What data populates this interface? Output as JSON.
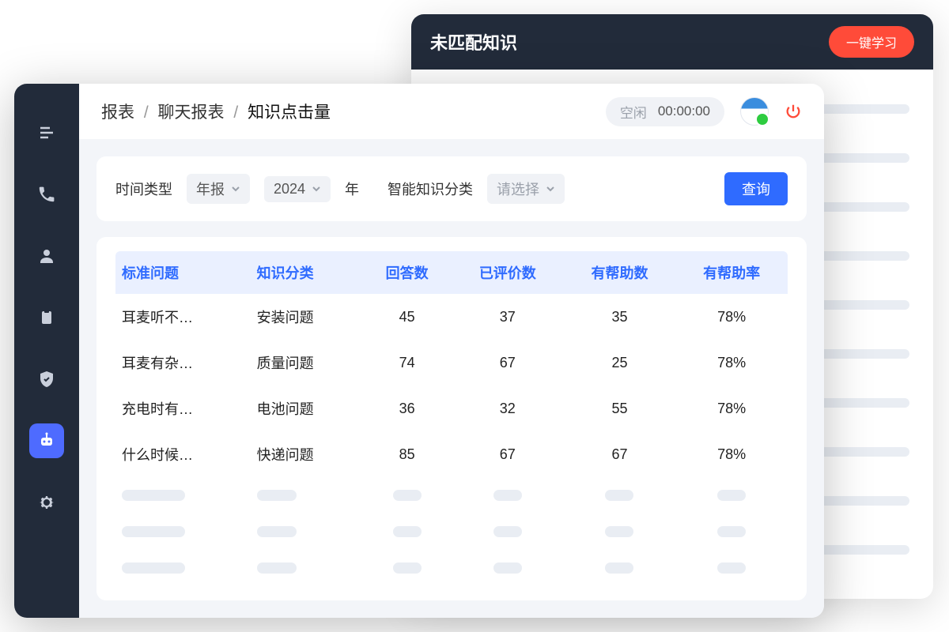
{
  "back_window": {
    "title": "未匹配知识",
    "learn_button": "一键学习"
  },
  "breadcrumb": {
    "root": "报表",
    "mid": "聊天报表",
    "current": "知识点击量"
  },
  "topbar": {
    "status_label": "空闲",
    "timer": "00:00:00"
  },
  "filters": {
    "time_type_label": "时间类型",
    "period_value": "年报",
    "year_value": "2024",
    "year_suffix": "年",
    "category_label": "智能知识分类",
    "category_placeholder": "请选择",
    "query_button": "查询"
  },
  "table": {
    "headers": [
      "标准问题",
      "知识分类",
      "回答数",
      "已评价数",
      "有帮助数",
      "有帮助率"
    ],
    "rows": [
      {
        "q": "耳麦听不…",
        "cat": "安装问题",
        "answers": "45",
        "rated": "37",
        "helpful": "35",
        "rate": "78%"
      },
      {
        "q": "耳麦有杂…",
        "cat": "质量问题",
        "answers": "74",
        "rated": "67",
        "helpful": "25",
        "rate": "78%"
      },
      {
        "q": "充电时有…",
        "cat": "电池问题",
        "answers": "36",
        "rated": "32",
        "helpful": "55",
        "rate": "78%"
      },
      {
        "q": "什么时候…",
        "cat": "快递问题",
        "answers": "85",
        "rated": "67",
        "helpful": "67",
        "rate": "78%"
      }
    ]
  }
}
